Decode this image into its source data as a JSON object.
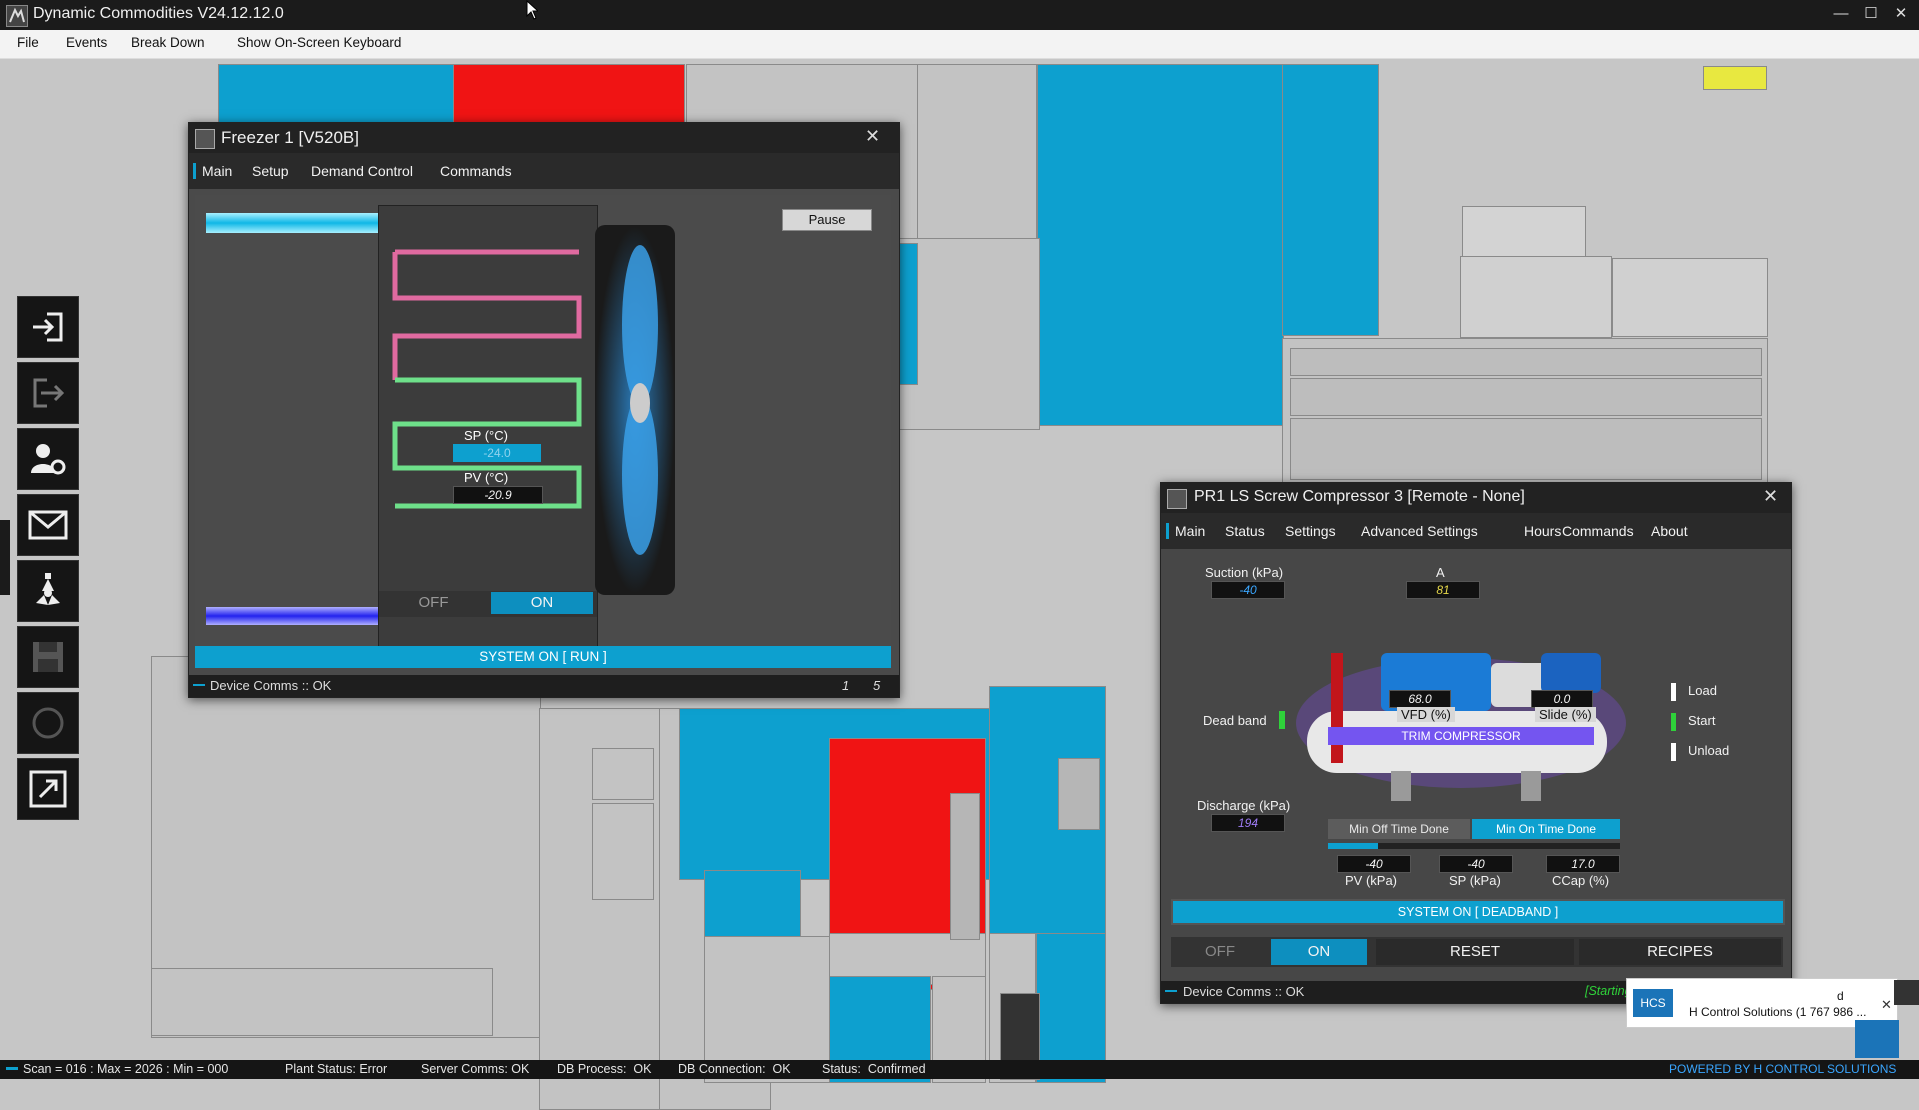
{
  "app": {
    "title": "Dynamic Commodities V24.12.12.0"
  },
  "menu": [
    "File",
    "Events",
    "Break Down",
    "Show On-Screen Keyboard"
  ],
  "toolbar_icons": [
    "login-icon",
    "logout-icon",
    "user-settings-icon",
    "mail-icon",
    "radiation-icon",
    "save-icon",
    "refresh-icon",
    "fullscreen-icon"
  ],
  "freezer": {
    "title": "Freezer 1 [V520B]",
    "tabs": [
      "Main",
      "Setup",
      "Demand Control",
      "Commands"
    ],
    "pause_label": "Pause",
    "sp_label": "SP (°C)",
    "sp_value": "-24.0",
    "pv_label": "PV (°C)",
    "pv_value": "-20.9",
    "off_label": "OFF",
    "on_label": "ON",
    "system_status": "SYSTEM ON [ RUN ]",
    "comms": "Device Comms :: OK",
    "page_current": "1",
    "page_total": "5"
  },
  "compressor": {
    "title": "PR1 LS Screw Compressor 3 [Remote - None]",
    "tabs": [
      "Main",
      "Status",
      "Settings",
      "Advanced Settings",
      "Hours",
      "Commands",
      "About"
    ],
    "suction_label": "Suction (kPa)",
    "suction_value": "-40",
    "amps_label": "A",
    "amps_value": "81",
    "deadband_label": "Dead band",
    "vfd_value": "68.0",
    "vfd_label": "VFD (%)",
    "slide_value": "0.0",
    "slide_label": "Slide (%)",
    "trim_label": "TRIM COMPRESSOR",
    "load_label": "Load",
    "start_label": "Start",
    "unload_label": "Unload",
    "discharge_label": "Discharge (kPa)",
    "discharge_value": "194",
    "min_off_label": "Min Off Time Done",
    "min_on_label": "Min On Time Done",
    "pv_value": "-40",
    "pv_label": "PV (kPa)",
    "sp_value": "-40",
    "sp_label": "SP (kPa)",
    "ccap_value": "17.0",
    "ccap_label": "CCap (%)",
    "system_status": "SYSTEM ON [ DEADBAND ]",
    "off_label": "OFF",
    "on_label": "ON",
    "reset_label": "RESET",
    "recipes_label": "RECIPES",
    "comms": "Device Comms :: OK",
    "seq": "[Starting Seq: 3]  [Main Seq: 3]"
  },
  "notification": {
    "text": "H Control Solutions (1 767 986 ...",
    "logo": "HCS",
    "partial": "d"
  },
  "status_bar": {
    "scan": "Scan = 016 : Max = 2026 : Min = 000",
    "plant": "Plant Status: Error",
    "server": "Server Comms: OK",
    "db_process": "DB Process:  OK",
    "db_connection": "DB Connection:  OK",
    "status": "Status:  Confirmed",
    "powered": "POWERED BY H CONTROL SOLUTIONS"
  },
  "colors": {
    "accent": "#0da0cf",
    "alarm": "#f01414",
    "ok_green": "#2fd23a"
  }
}
